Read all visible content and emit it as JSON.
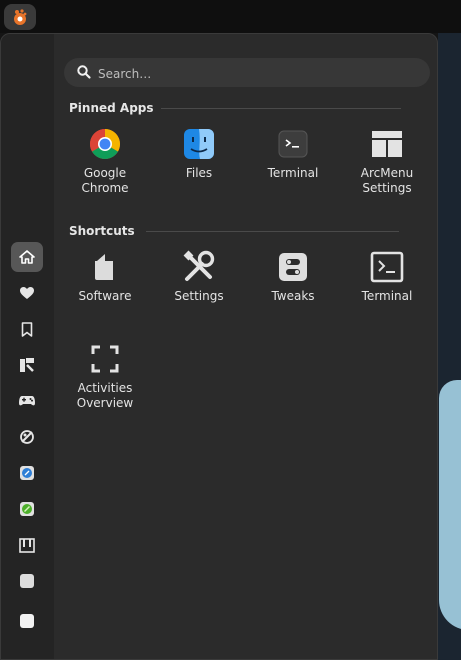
{
  "menu": {
    "search": {
      "placeholder": "Search…"
    },
    "pinned": {
      "title": "Pinned Apps",
      "items": [
        {
          "label": "Google\nChrome",
          "icon": "chrome-icon"
        },
        {
          "label": "Files",
          "icon": "finder-icon"
        },
        {
          "label": "Terminal",
          "icon": "terminal-icon"
        },
        {
          "label": "ArcMenu\nSettings",
          "icon": "arcmenu-settings-icon"
        }
      ]
    },
    "shortcuts": {
      "title": "Shortcuts",
      "items": [
        {
          "label": "Software",
          "icon": "software-bag-icon"
        },
        {
          "label": "Settings",
          "icon": "tools-icon"
        },
        {
          "label": "Tweaks",
          "icon": "tweaks-icon"
        },
        {
          "label": "Terminal",
          "icon": "terminal-outline-icon"
        },
        {
          "label": "Activities\nOverview",
          "icon": "activities-overview-icon"
        }
      ]
    },
    "sidebar": [
      "home-icon",
      "favorites-heart-icon",
      "bookmark-icon",
      "development-icon",
      "games-controller-icon",
      "graphics-icon",
      "internet-icon",
      "office-icon",
      "multimedia-icon",
      "other-icon",
      "utilities-icon"
    ]
  },
  "colors": {
    "accent_chrome_red": "#db4437",
    "finder_blue": "#1e88e5",
    "active_side": "#575757"
  }
}
